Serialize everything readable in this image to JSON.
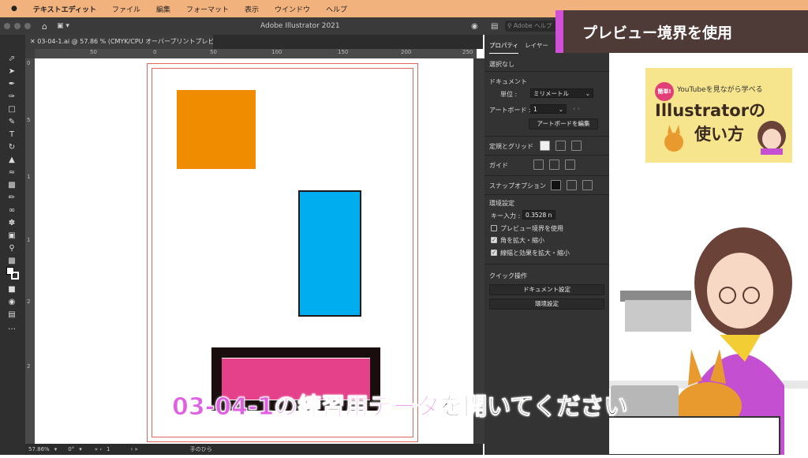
{
  "menubar": {
    "apple": "",
    "items": [
      "テキストエディット",
      "ファイル",
      "編集",
      "フォーマット",
      "表示",
      "ウインドウ",
      "ヘルプ"
    ]
  },
  "window": {
    "title": "Adobe Illustrator 2021",
    "search_placeholder": "Adobe ヘルプ"
  },
  "document_tab": {
    "label": "03-04-1.ai @ 57.86 % (CMYK/CPU オーバープリントプレビュー)"
  },
  "rulers": {
    "h_labels": [
      "50",
      "0",
      "50",
      "100",
      "150",
      "200",
      "250"
    ],
    "v_labels": [
      "0",
      "5",
      "1",
      "1",
      "2",
      "2"
    ]
  },
  "artwork": {
    "orange_color": "#f08c00",
    "blue_color": "#00aeef",
    "pink_color": "#e5408a",
    "dark_stroke": "#1a0d0d"
  },
  "statusbar": {
    "zoom": "57.86%",
    "rotation": "0°",
    "artboard": "1",
    "tool": "手のひら"
  },
  "panel": {
    "tabs": [
      "プロパティ",
      "レイヤー"
    ],
    "no_selection": "選択なし",
    "document_heading": "ドキュメント",
    "units_label": "単位 :",
    "units_value": "ミリメートル",
    "artboard_label": "アートボード :",
    "artboard_value": "1",
    "edit_artboards": "アートボードを編集",
    "rulers_grid": "定規とグリッド",
    "guides": "ガイド",
    "snap_options": "スナップオプション",
    "preferences_heading": "環境設定",
    "key_input_label": "キー入力 :",
    "key_input_value": "0.3528 n",
    "prefs": [
      {
        "label": "プレビュー境界を使用",
        "checked": false
      },
      {
        "label": "角を拡大・縮小",
        "checked": true
      },
      {
        "label": "線幅と効果を拡大・縮小",
        "checked": true
      }
    ],
    "quick_actions": "クイック操作",
    "doc_setup": "ドキュメント設定",
    "preferences_btn": "環境設定"
  },
  "overlay": {
    "title_badge": "プレビュー境界を使用",
    "yt_badge": "簡単!",
    "yt_sub": "YouTubeを見ながら学べる",
    "yt_title1": "Illustratorの",
    "yt_title2": "使い方"
  },
  "subtitle": {
    "part_a": "03-04-1の練習用データ",
    "part_b": "を開いてください"
  }
}
